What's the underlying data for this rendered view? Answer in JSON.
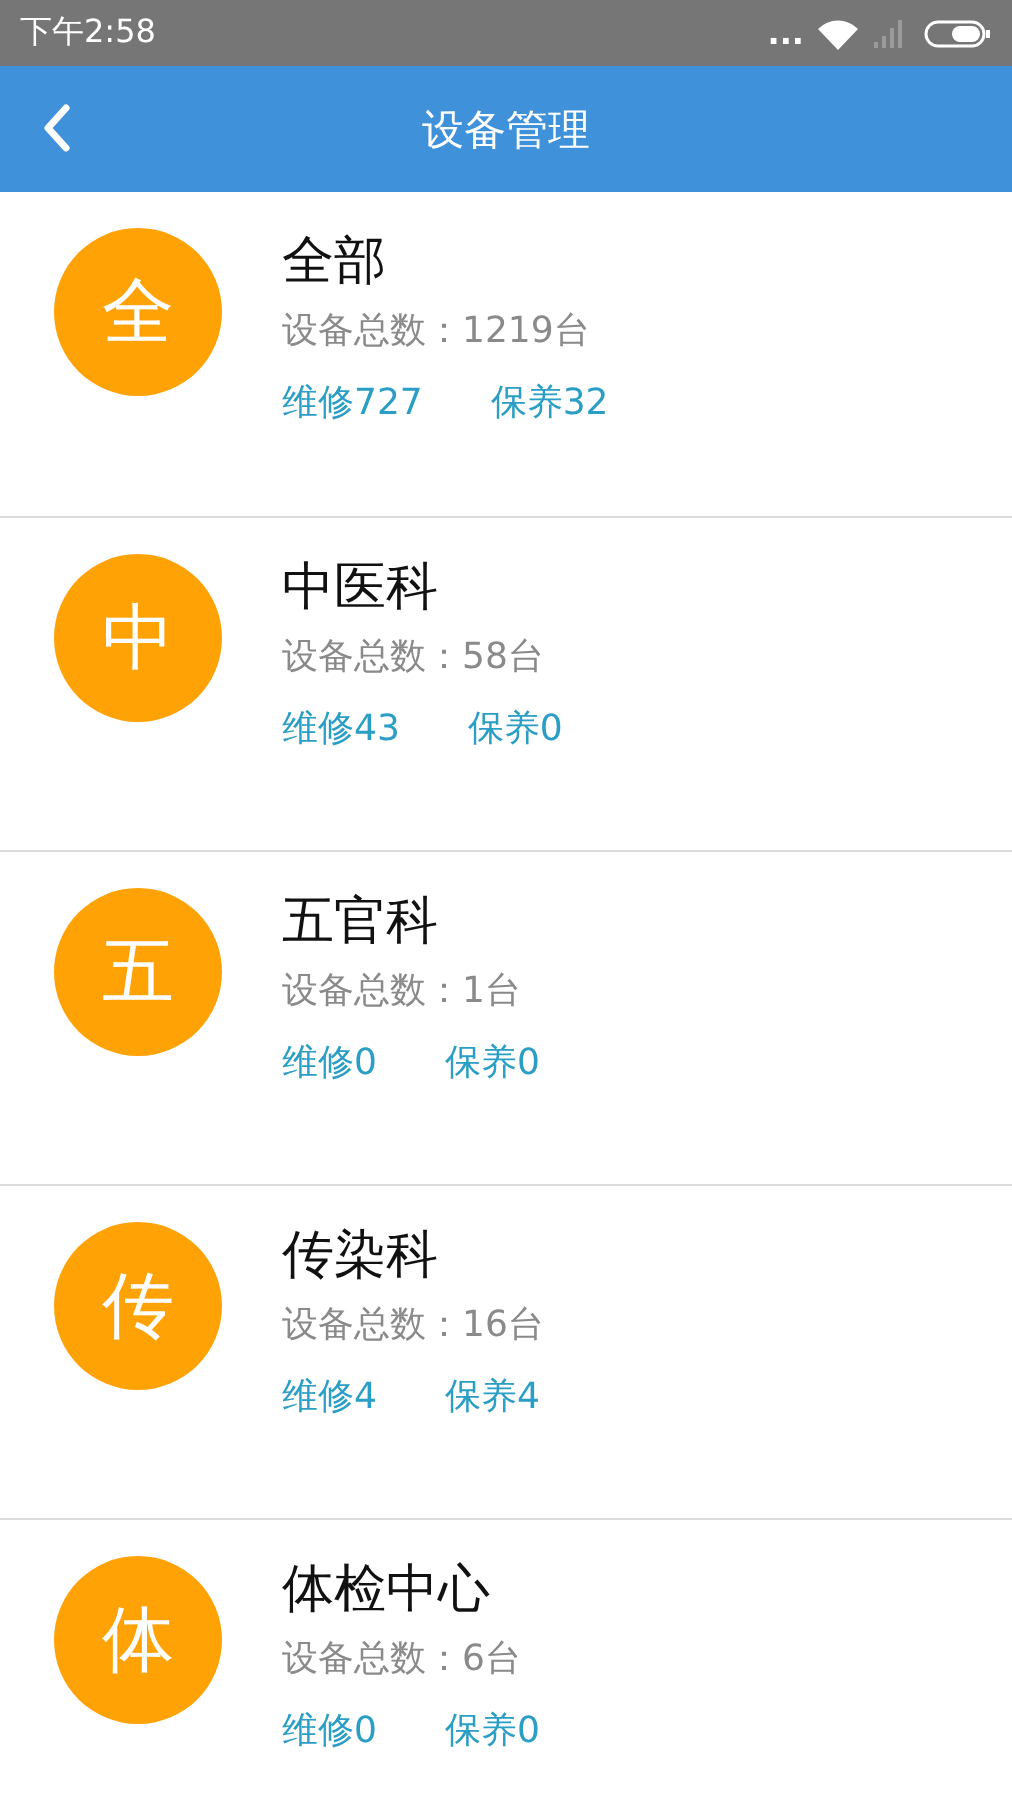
{
  "status_bar": {
    "time": "下午2:58",
    "more": "..."
  },
  "header": {
    "title": "设备管理"
  },
  "departments": [
    {
      "badge": "全",
      "name": "全部",
      "total": "设备总数：1219台",
      "repair": "维修727",
      "maintenance": "保养32"
    },
    {
      "badge": "中",
      "name": "中医科",
      "total": "设备总数：58台",
      "repair": "维修43",
      "maintenance": "保养0"
    },
    {
      "badge": "五",
      "name": "五官科",
      "total": "设备总数：1台",
      "repair": "维修0",
      "maintenance": "保养0"
    },
    {
      "badge": "传",
      "name": "传染科",
      "total": "设备总数：16台",
      "repair": "维修4",
      "maintenance": "保养4"
    },
    {
      "badge": "体",
      "name": "体检中心",
      "total": "设备总数：6台",
      "repair": "维修0",
      "maintenance": "保养0"
    }
  ]
}
